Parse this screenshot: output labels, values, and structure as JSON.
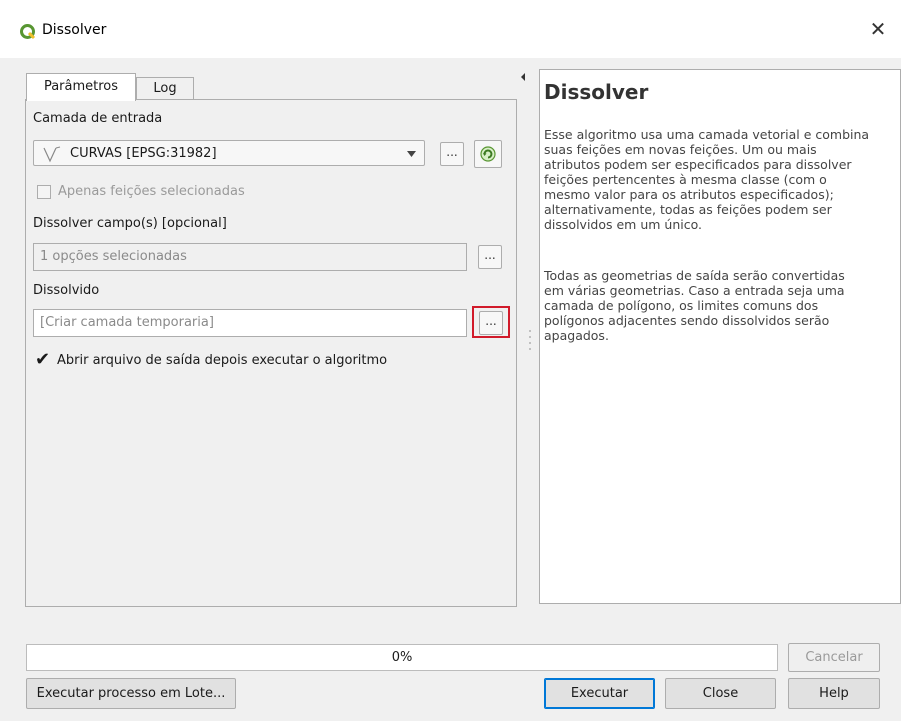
{
  "window": {
    "title": "Dissolver",
    "close_glyph": "✕"
  },
  "tabs": [
    {
      "label": "Parâmetros",
      "active": true
    },
    {
      "label": "Log",
      "active": false
    }
  ],
  "params": {
    "input_layer_label": "Camada de entrada",
    "input_layer_value": "CURVAS [EPSG:31982]",
    "selected_only_label": "Apenas feições selecionadas",
    "dissolve_fields_label": "Dissolver campo(s) [opcional]",
    "dissolve_fields_value": "1 opções selecionadas",
    "output_label": "Dissolvido",
    "output_placeholder": "[Criar camada temporaria]",
    "open_after_label": "Abrir arquivo de saída depois executar o algoritmo",
    "browse_glyph": "...",
    "check_glyph": "✔"
  },
  "help": {
    "title": "Dissolver",
    "lines_p1": [
      "Esse algoritmo usa uma camada vetorial e combina",
      "suas feições em novas feições. Um ou mais",
      "atributos podem ser especificados para dissolver",
      "feições pertencentes à mesma classe (com o",
      "mesmo valor para os atributos especificados);",
      "alternativamente, todas as feições podem ser",
      "dissolvidos em um único."
    ],
    "lines_p2": [
      "Todas as geometrias de saída serão convertidas",
      "em várias geometrias. Caso a entrada seja uma",
      "camada de polígono, os limites comuns dos",
      "polígonos adjacentes sendo dissolvidos serão",
      "apagados."
    ]
  },
  "progress": {
    "text": "0%",
    "value": 0
  },
  "buttons": {
    "cancel": "Cancelar",
    "batch": "Executar processo em Lote...",
    "run": "Executar",
    "close": "Close",
    "help": "Help"
  },
  "colors": {
    "accent": "#0078d7",
    "highlight_box": "#d11a2a",
    "qgis_green": "#589632"
  }
}
